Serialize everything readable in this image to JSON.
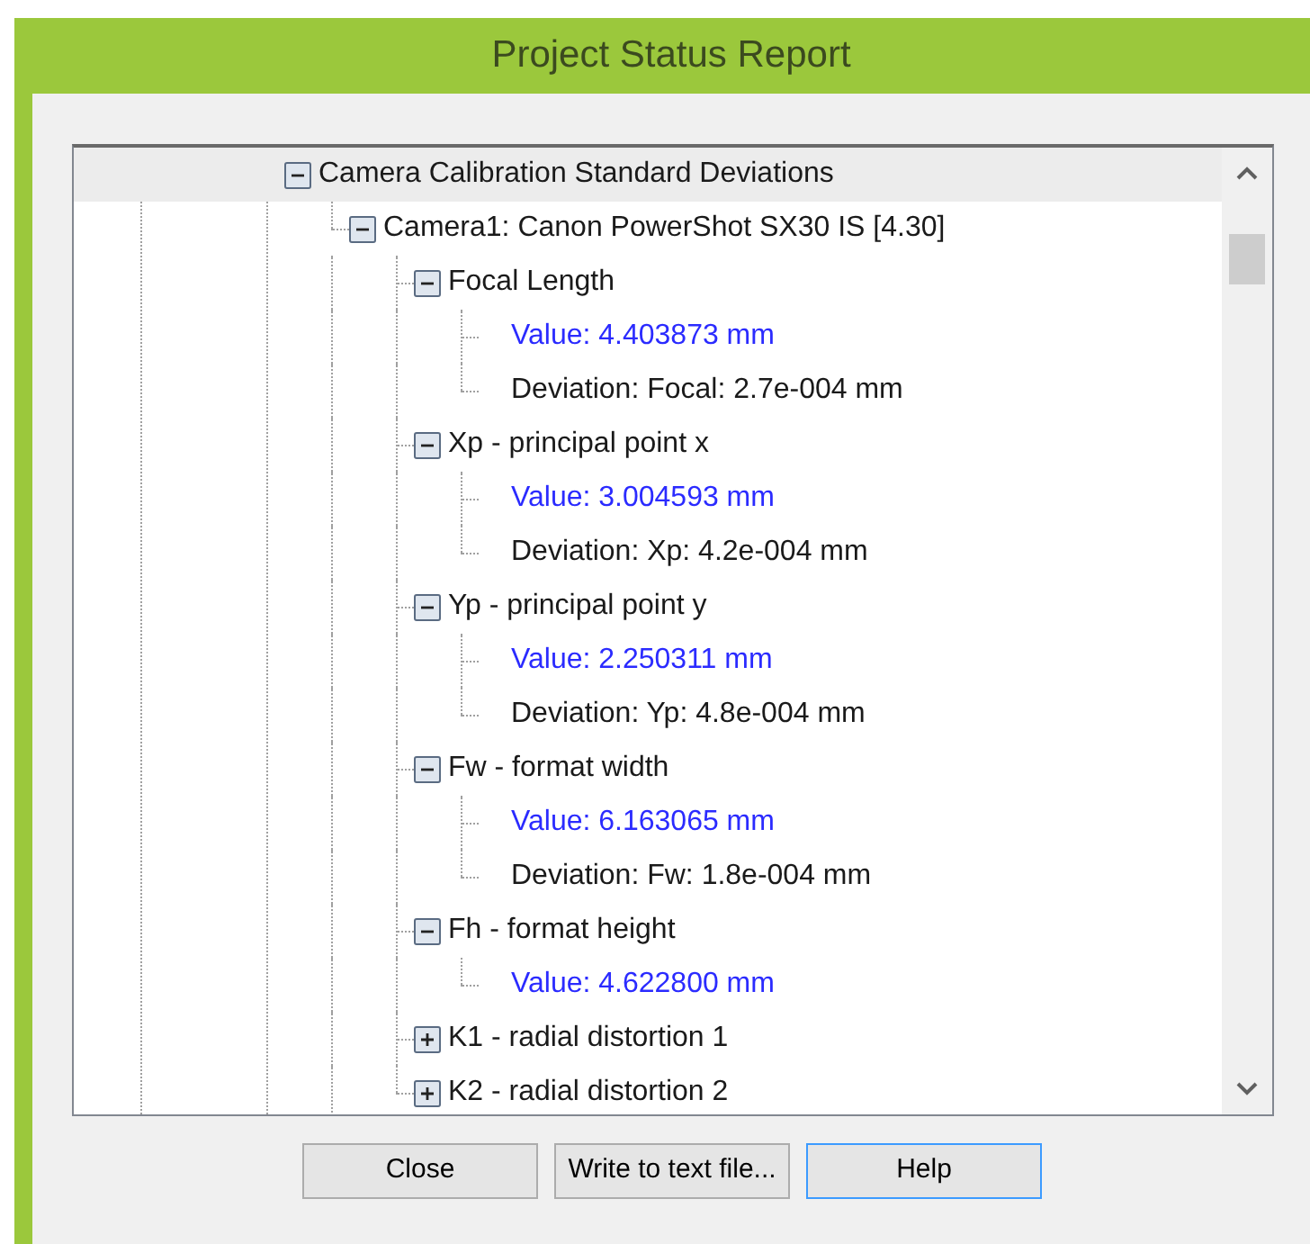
{
  "window": {
    "title": "Project Status Report"
  },
  "tree": [
    {
      "label": "Camera Calibration Standard Deviations",
      "expanded": true,
      "selected": true,
      "children": [
        {
          "label": "Camera1: Canon PowerShot SX30 IS [4.30]",
          "expanded": true,
          "selected": false,
          "children": [
            {
              "label": "Focal Length",
              "expanded": true,
              "selected": false,
              "children": [
                {
                  "label": "Value: 4.403873 mm",
                  "kind": "value",
                  "selected": false
                },
                {
                  "label": "Deviation: Focal: 2.7e-004 mm",
                  "kind": "deviation",
                  "selected": false
                }
              ]
            },
            {
              "label": "Xp - principal point x",
              "expanded": true,
              "selected": false,
              "children": [
                {
                  "label": "Value: 3.004593 mm",
                  "kind": "value",
                  "selected": false
                },
                {
                  "label": "Deviation: Xp: 4.2e-004 mm",
                  "kind": "deviation",
                  "selected": false
                }
              ]
            },
            {
              "label": "Yp - principal point y",
              "expanded": true,
              "selected": false,
              "children": [
                {
                  "label": "Value: 2.250311 mm",
                  "kind": "value",
                  "selected": false
                },
                {
                  "label": "Deviation: Yp: 4.8e-004 mm",
                  "kind": "deviation",
                  "selected": false
                }
              ]
            },
            {
              "label": "Fw - format width",
              "expanded": true,
              "selected": false,
              "children": [
                {
                  "label": "Value: 6.163065 mm",
                  "kind": "value",
                  "selected": false
                },
                {
                  "label": "Deviation: Fw: 1.8e-004 mm",
                  "kind": "deviation",
                  "selected": false
                }
              ]
            },
            {
              "label": "Fh - format height",
              "expanded": true,
              "selected": false,
              "children": [
                {
                  "label": "Value: 4.622800 mm",
                  "kind": "value",
                  "selected": false
                }
              ]
            },
            {
              "label": "K1 - radial distortion 1",
              "expanded": false,
              "selected": false
            },
            {
              "label": "K2 - radial distortion 2",
              "expanded": false,
              "selected": false
            }
          ]
        }
      ]
    }
  ],
  "buttons": [
    {
      "label": "Close",
      "focused": false
    },
    {
      "label": "Write to text file...",
      "focused": false
    },
    {
      "label": "Help",
      "focused": true
    }
  ]
}
